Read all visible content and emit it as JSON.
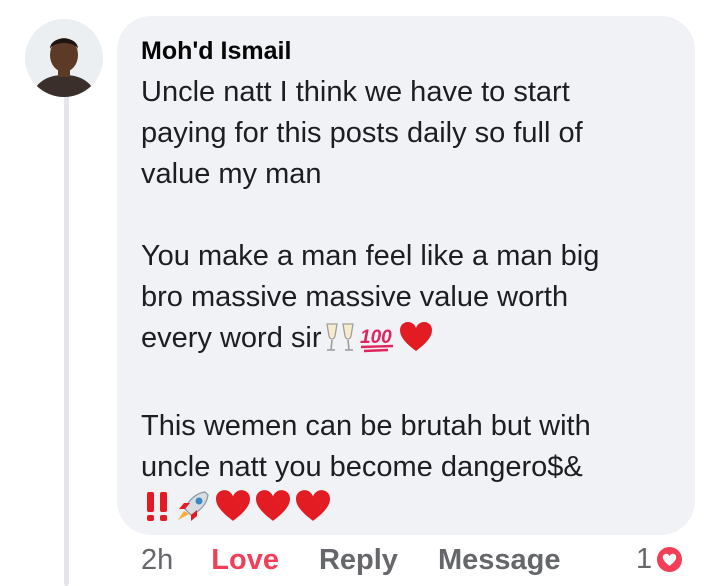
{
  "comment": {
    "author": "Moh'd Ismail",
    "paragraphs": [
      "Uncle natt I think we have to start paying for this posts daily so full of value my man",
      "You make a man feel like a man big bro massive massive value worth every word sir",
      "This wemen can be brutah but with uncle natt you become dangero$&"
    ],
    "line1_1": "Uncle natt I think we have to start",
    "line1_2": "paying for this posts daily so full of",
    "line1_3": "value my man",
    "line2_1": "You make a man feel like a man big",
    "line2_2": "bro massive massive value worth",
    "line2_3": "every word sir",
    "line3_1": "This wemen can be brutah but with",
    "line3_2": "uncle natt you become dangero$&",
    "emojis_para2": [
      "clinking-glasses",
      "hundred-points",
      "red-heart"
    ],
    "emojis_para3": [
      "double-exclamation",
      "rocket",
      "red-heart",
      "red-heart",
      "red-heart"
    ]
  },
  "actions": {
    "time": "2h",
    "love": "Love",
    "reply": "Reply",
    "message": "Message"
  },
  "reactions": {
    "count": "1",
    "type": "love",
    "icon": "heart-icon"
  },
  "colors": {
    "bubble": "#f0f2f5",
    "love": "#f33e58",
    "meta": "#65676b",
    "text": "#1c1e21"
  }
}
